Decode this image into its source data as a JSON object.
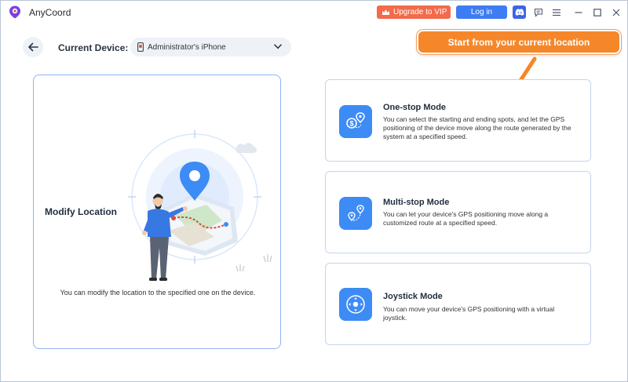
{
  "app": {
    "title": "AnyCoord"
  },
  "titlebar": {
    "upgrade_label": "Upgrade to VIP",
    "login_label": "Log in",
    "icons": [
      "discord-icon",
      "feedback-icon",
      "menu-icon",
      "minimize-icon",
      "maximize-icon",
      "close-icon"
    ]
  },
  "device": {
    "label": "Current Device:",
    "selected": "Administrator's iPhone"
  },
  "callout": {
    "text": "Start from your current location"
  },
  "modify": {
    "title": "Modify Location",
    "description": "You can modify the location to the specified one on the device."
  },
  "modes": [
    {
      "title": "One-stop Mode",
      "description": "You can select the starting and ending spots, and let the GPS positioning of the device move along the route generated by the system at a specified speed.",
      "icon": "route-dollar-icon"
    },
    {
      "title": "Multi-stop Mode",
      "description": "You can let your device's GPS positioning move along a customized route at a specified speed.",
      "icon": "multi-pin-route-icon"
    },
    {
      "title": "Joystick Mode",
      "description": "You can move your device's GPS positioning with a virtual joystick.",
      "icon": "joystick-icon"
    }
  ],
  "colors": {
    "accent": "#3d8bf5",
    "vip": "#f26b4a",
    "login": "#3d7cf4",
    "callout": "#f5872a",
    "card_border": "#c6d5eb"
  }
}
